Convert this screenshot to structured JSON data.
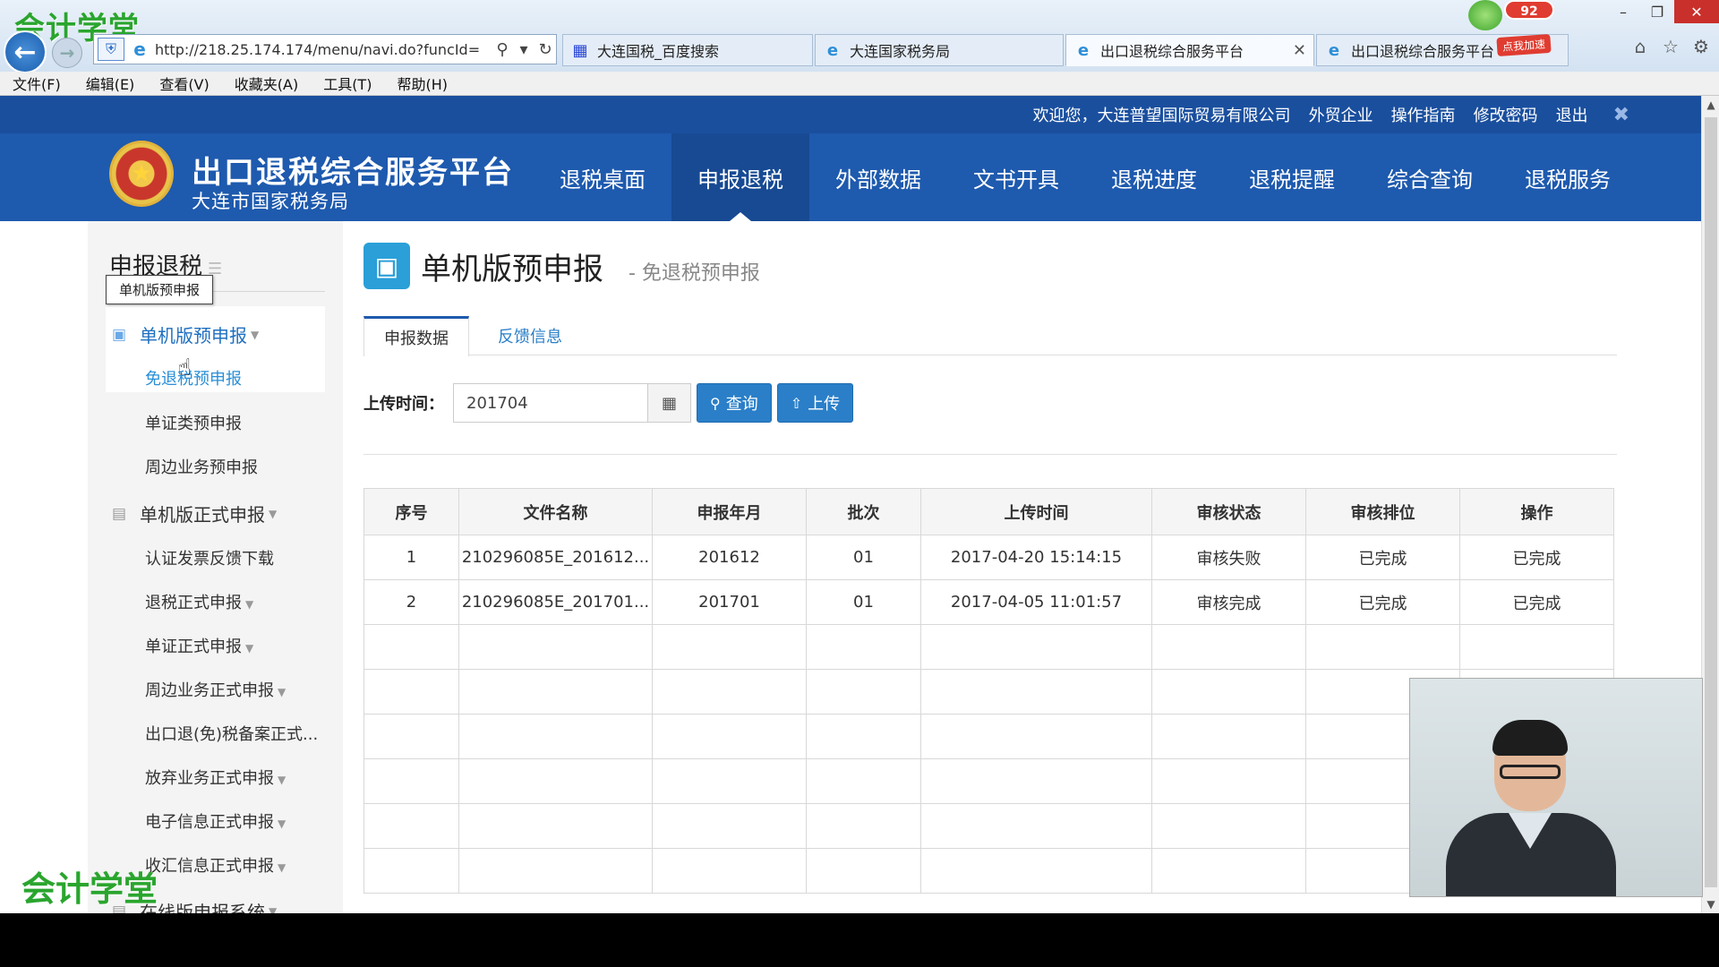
{
  "browser": {
    "watermark_top": "会计学堂",
    "url": "http://218.25.174.174/menu/navi.do?funcId=",
    "tabs": [
      {
        "label": "大连国税_百度搜索",
        "icon": "baidu-icon"
      },
      {
        "label": "大连国家税务局",
        "icon": "ie-icon"
      },
      {
        "label": "出口退税综合服务平台",
        "icon": "ie-icon",
        "active": true
      },
      {
        "label": "出口退税综合服务平台",
        "icon": "ie-icon"
      }
    ],
    "badge": "92",
    "speed_badge": "点我加速",
    "menu": [
      "文件(F)",
      "编辑(E)",
      "查看(V)",
      "收藏夹(A)",
      "工具(T)",
      "帮助(H)"
    ]
  },
  "topbar": {
    "welcome": "欢迎您，大连普望国际贸易有限公司",
    "links": [
      "外贸企业",
      "操作指南",
      "修改密码",
      "退出"
    ]
  },
  "header": {
    "title": "出口退税综合服务平台",
    "subtitle": "大连市国家税务局",
    "nav": [
      "退税桌面",
      "申报退税",
      "外部数据",
      "文书开具",
      "退税进度",
      "退税提醒",
      "综合查询",
      "退税服务"
    ],
    "active_nav": "申报退税"
  },
  "sidebar": {
    "heading": "申报退税",
    "tooltip": "单机版预申报",
    "group1": "单机版预申报",
    "group1_items": [
      "免退税预申报",
      "单证类预申报",
      "周边业务预申报"
    ],
    "group2": "单机版正式申报",
    "group2_items": [
      "认证发票反馈下载",
      "退税正式申报",
      "单证正式申报",
      "周边业务正式申报",
      "出口退(免)税备案正式...",
      "放弃业务正式申报",
      "电子信息正式申报",
      "收汇信息正式申报"
    ],
    "group3": "在线版申报系统",
    "watermark_bottom": "会计学堂"
  },
  "main": {
    "title": "单机版预申报",
    "subtitle": "- 免退税预申报",
    "tabs": [
      "申报数据",
      "反馈信息"
    ],
    "filter_label": "上传时间：",
    "filter_value": "201704",
    "query_btn": "查询",
    "upload_btn": "上传",
    "columns": [
      "序号",
      "文件名称",
      "申报年月",
      "批次",
      "上传时间",
      "审核状态",
      "审核排位",
      "操作"
    ],
    "rows": [
      [
        "1",
        "210296085E_201612...",
        "201612",
        "01",
        "2017-04-20 15:14:15",
        "审核失败",
        "已完成",
        "已完成"
      ],
      [
        "2",
        "210296085E_201701...",
        "201701",
        "01",
        "2017-04-05 11:01:57",
        "审核完成",
        "已完成",
        "已完成"
      ]
    ]
  }
}
